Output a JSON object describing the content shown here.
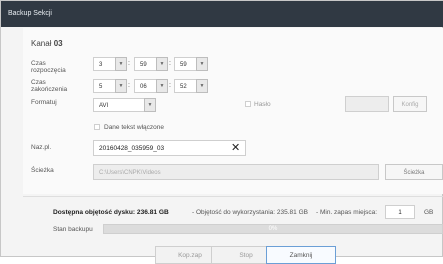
{
  "window": {
    "title": "Backup Sekcji"
  },
  "channel": {
    "label": "Kanał",
    "value": "03"
  },
  "start_time": {
    "label": "Czas rozpoczęcia",
    "hh": "3",
    "mm": "59",
    "ss": "59"
  },
  "end_time": {
    "label": "Czas zakończenia",
    "hh": "5",
    "mm": "06",
    "ss": "52"
  },
  "format": {
    "label": "Formatuj",
    "value": "AVI"
  },
  "password": {
    "checkbox_label": "Hasło",
    "value": "",
    "config_button": "Konfig"
  },
  "text_overlay": {
    "checkbox_label": "Dane tekst włączone"
  },
  "filename": {
    "label": "Naz.pl.",
    "value": "20160428_035959_03"
  },
  "path": {
    "label": "Ścieżka",
    "value": "C:\\Users\\CNPK\\Videos",
    "button": "Ścieżka"
  },
  "disk": {
    "available_label": "Dostępna objętość dysku:",
    "available_value": "236.81 GB",
    "used_label": "- Objętość do wykorzystania:",
    "used_value": "235.81 GB",
    "min_label": "- Min. zapas miejsca:",
    "min_value": "1",
    "min_unit": "GB"
  },
  "backup_status": {
    "label": "Stan backupu",
    "progress_text": "0%",
    "progress_fraction": 0
  },
  "buttons": {
    "backup": "Kop.zap",
    "stop": "Stop",
    "close": "Zamknij"
  },
  "icons": {
    "spin_down": "▼",
    "clear": "✕"
  }
}
